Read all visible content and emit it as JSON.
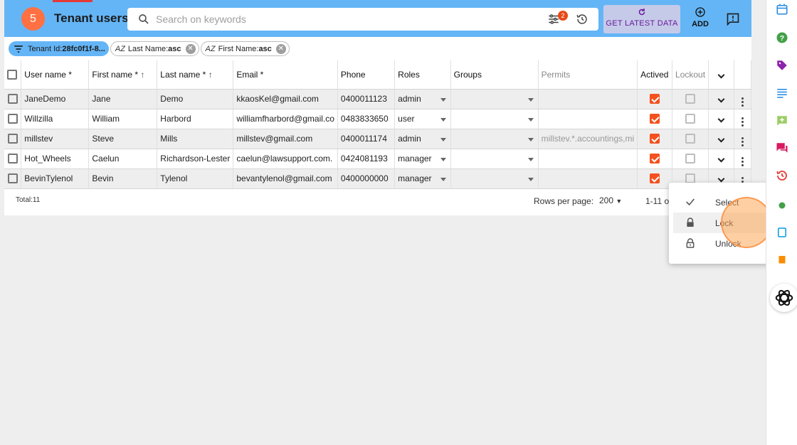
{
  "header": {
    "count_badge": "5",
    "title": "Tenant users",
    "search_placeholder": "Search on keywords",
    "filter_badge": "2",
    "get_latest_label": "GET LATEST DATA",
    "add_label": "ADD"
  },
  "chips": [
    {
      "prefix": "Tenant Id:",
      "value": "28fc0f1f-8..."
    },
    {
      "prefix": "Last Name:",
      "value": "asc"
    },
    {
      "prefix": "First Name:",
      "value": "asc"
    }
  ],
  "columns": [
    "User name *",
    "First name *",
    "Last name *",
    "Email *",
    "Phone",
    "Roles",
    "Groups",
    "Permits",
    "Actived",
    "Lockout"
  ],
  "rows": [
    {
      "username": "JaneDemo",
      "first": "Jane",
      "last": "Demo",
      "email": "kkaosKel@gmail.com",
      "phone": "0400011123",
      "role": "admin",
      "group": "",
      "permits": "",
      "actived": true,
      "lockout": false
    },
    {
      "username": "Willzilla",
      "first": "William",
      "last": "Harbord",
      "email": "williamfharbord@gmail.co",
      "phone": "0483833650",
      "role": "user",
      "group": "",
      "permits": "",
      "actived": true,
      "lockout": false
    },
    {
      "username": "millstev",
      "first": "Steve",
      "last": "Mills",
      "email": "millstev@gmail.com",
      "phone": "0400011174",
      "role": "admin",
      "group": "",
      "permits": "millstev.*.accountings,mi",
      "actived": true,
      "lockout": false
    },
    {
      "username": "Hot_Wheels",
      "first": "Caelun",
      "last": "Richardson-Lester",
      "email": "caelun@lawsupport.com.",
      "phone": "0424081193",
      "role": "manager",
      "group": "",
      "permits": "",
      "actived": true,
      "lockout": false
    },
    {
      "username": "BevinTylenol",
      "first": "Bevin",
      "last": "Tylenol",
      "email": "bevantylenol@gmail.com",
      "phone": "0400000000",
      "role": "manager",
      "group": "",
      "permits": "",
      "actived": true,
      "lockout": false
    }
  ],
  "footer": {
    "total": "Total:11",
    "rows_per_page_label": "Rows per page:",
    "rows_per_page_value": "200",
    "range": "1-11 o"
  },
  "context_menu": {
    "items": [
      "Select",
      "Lock",
      "Unlock"
    ]
  },
  "colors": {
    "header_bg": "#64b5f6",
    "accent": "#f4511e",
    "badge": "#ff7043",
    "button_bg": "#c5cae9"
  }
}
